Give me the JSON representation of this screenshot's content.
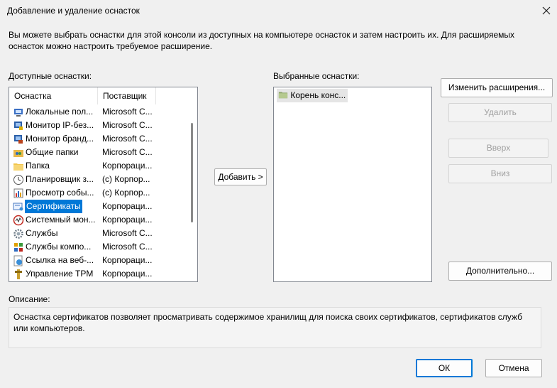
{
  "window": {
    "title": "Добавление и удаление оснасток"
  },
  "intro_text": "Вы можете выбрать оснастки для этой консоли из доступных на компьютере оснасток и затем настроить их. Для расширяемых оснасток можно настроить требуемое расширение.",
  "available": {
    "label": "Доступные оснастки:",
    "columns": {
      "name": "Оснастка",
      "vendor": "Поставщик"
    },
    "items": [
      {
        "name": "Локальные пол...",
        "vendor": "Microsoft C...",
        "icon": "policy-icon"
      },
      {
        "name": "Монитор IP-без...",
        "vendor": "Microsoft C...",
        "icon": "ip-security-icon"
      },
      {
        "name": "Монитор бранд...",
        "vendor": "Microsoft C...",
        "icon": "firewall-icon"
      },
      {
        "name": "Общие папки",
        "vendor": "Microsoft C...",
        "icon": "shared-folders-icon"
      },
      {
        "name": "Папка",
        "vendor": "Корпораци...",
        "icon": "folder-icon"
      },
      {
        "name": "Планировщик з...",
        "vendor": "(c) Корпор...",
        "icon": "clock-icon"
      },
      {
        "name": "Просмотр собы...",
        "vendor": "(c) Корпор...",
        "icon": "event-viewer-icon"
      },
      {
        "name": "Сертификаты",
        "vendor": "Корпораци...",
        "icon": "certificate-icon",
        "selected": true
      },
      {
        "name": "Системный мон...",
        "vendor": "Корпораци...",
        "icon": "system-monitor-icon"
      },
      {
        "name": "Службы",
        "vendor": "Microsoft C...",
        "icon": "gear-icon"
      },
      {
        "name": "Службы компо...",
        "vendor": "Microsoft C...",
        "icon": "component-services-icon"
      },
      {
        "name": "Ссылка на веб-...",
        "vendor": "Корпораци...",
        "icon": "web-link-icon"
      },
      {
        "name": "Управление TPM",
        "vendor": "Корпораци...",
        "icon": "tpm-icon"
      }
    ]
  },
  "add_button": "Добавить >",
  "selected": {
    "label": "Выбранные оснастки:",
    "items": [
      {
        "name": "Корень конс...",
        "icon": "console-root-folder-icon"
      }
    ]
  },
  "buttons": {
    "edit_extensions": "Изменить расширения...",
    "remove": "Удалить",
    "move_up": "Вверх",
    "move_down": "Вниз",
    "advanced": "Дополнительно...",
    "ok": "ОК",
    "cancel": "Отмена"
  },
  "description": {
    "label": "Описание:",
    "text": "Оснастка сертификатов позволяет просматривать содержимое хранилищ для поиска своих сертификатов, сертификатов служб или компьютеров."
  },
  "colors": {
    "selection": "#0078d7",
    "border": "#828790"
  }
}
